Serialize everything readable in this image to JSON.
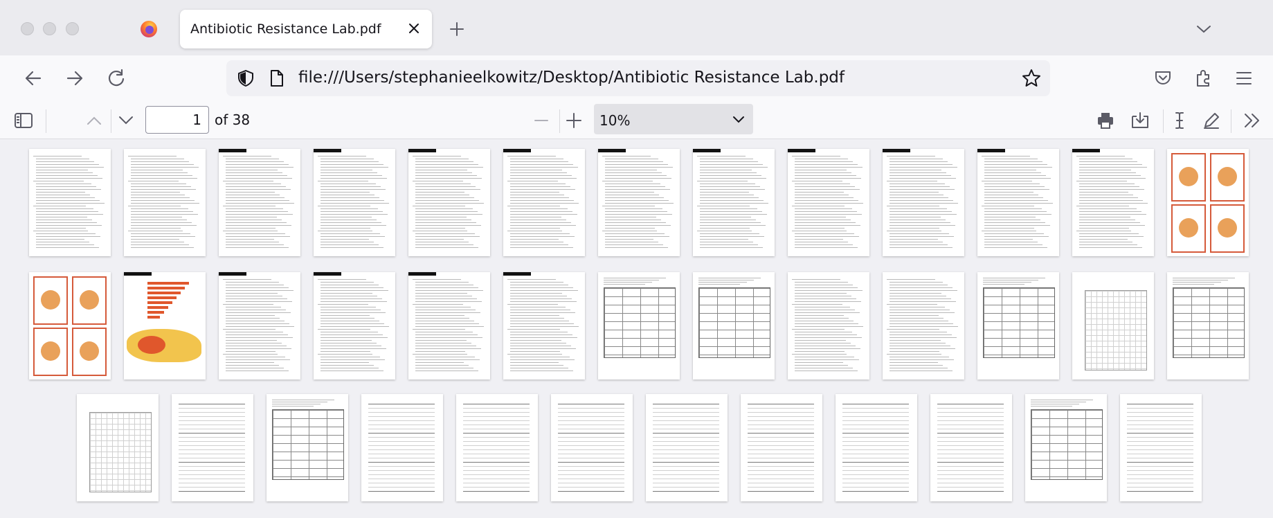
{
  "browser": {
    "tab_title": "Antibiotic Resistance Lab.pdf",
    "url": "file:///Users/stephanieelkowitz/Desktop/Antibiotic Resistance Lab.pdf"
  },
  "pdf_toolbar": {
    "current_page": "1",
    "page_count_label": "of 38",
    "zoom": "10%"
  },
  "document": {
    "total_pages": 38,
    "visible_thumbnails": 38
  }
}
